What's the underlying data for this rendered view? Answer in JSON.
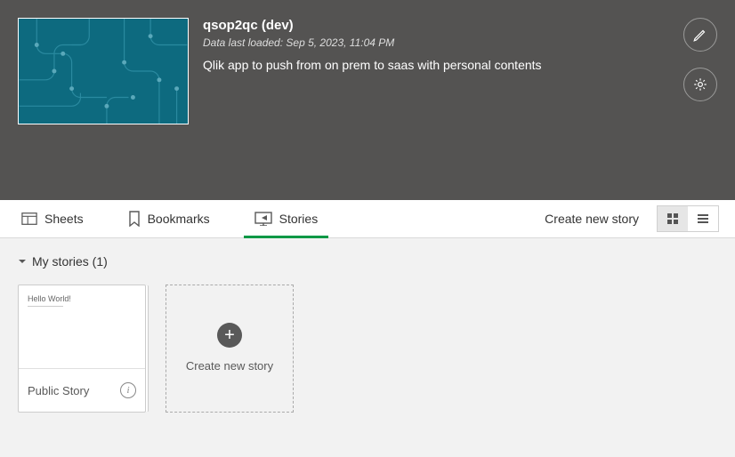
{
  "app": {
    "title": "qsop2qc (dev)",
    "loaded": "Data last loaded: Sep 5, 2023, 11:04 PM",
    "description": "Qlik app to push from on prem to saas with personal contents"
  },
  "tabs": {
    "sheets": "Sheets",
    "bookmarks": "Bookmarks",
    "stories": "Stories"
  },
  "toolbar": {
    "create_story": "Create new story"
  },
  "section": {
    "title": "My stories (1)"
  },
  "story": {
    "preview": "Hello World!",
    "title": "Public Story"
  },
  "new_card": {
    "label": "Create new story"
  }
}
